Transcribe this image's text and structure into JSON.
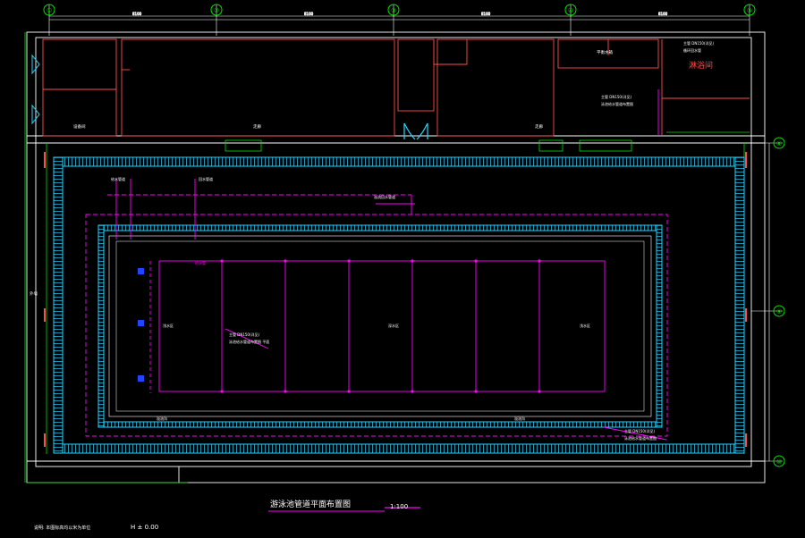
{
  "grid_top": [
    "①",
    "②",
    "③",
    "④",
    "⑤"
  ],
  "grid_right": [
    "⑧",
    "⑨",
    "⑩"
  ],
  "rooms": {
    "sauna": "淋浴间",
    "left_small": "设备间",
    "corridor_left": "走廊",
    "corridor_right": "走廊",
    "equip_room": "平衡水箱"
  },
  "annotations": {
    "pipe_main": "给水管",
    "note_top_right_a": "主管 DN150(详见)",
    "note_top_right_b": "循环回水管",
    "note_mid_right_a": "主管 DN150(详见)",
    "note_mid_right_b": "泳池给水管道布置图",
    "note_inner_a": "主管 DN150(详见)",
    "note_inner_b": "泳池给水管道布置图 平面",
    "note_bottom_a": "主管 DN150(详见)",
    "note_bottom_b": "泳池给水管道布置图",
    "label_top_left_1": "给水管道",
    "label_top_left_2": "回水管道",
    "label_top_mid": "溢流回水管道",
    "pool_left": "浅水区",
    "pool_center": "深水区",
    "pool_right": "浅水区",
    "left_wall": "外墙",
    "overflow_a": "溢流沟",
    "overflow_b": "溢流沟"
  },
  "title": "游泳池管道平面布置图",
  "scale": "1:100",
  "footer_left": "说明: 本图标高均以米为单位",
  "footer_elev": "H ± 0.00",
  "colors": {
    "white": "#ffffff",
    "red": "#ff4d4d",
    "magenta": "#ff00ff",
    "cyan": "#29d5ff",
    "green": "#00e000",
    "blue": "#2244ff"
  }
}
